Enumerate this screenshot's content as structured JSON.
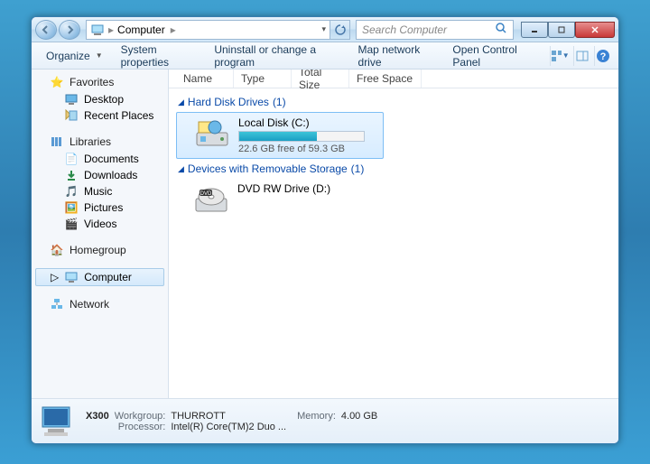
{
  "address": {
    "location": "Computer"
  },
  "search": {
    "placeholder": "Search Computer"
  },
  "toolbar": {
    "organize": "Organize",
    "system_properties": "System properties",
    "uninstall": "Uninstall or change a program",
    "map_drive": "Map network drive",
    "control_panel": "Open Control Panel"
  },
  "sidebar": {
    "favorites": {
      "label": "Favorites",
      "items": [
        "Desktop",
        "Recent Places"
      ]
    },
    "libraries": {
      "label": "Libraries",
      "items": [
        "Documents",
        "Downloads",
        "Music",
        "Pictures",
        "Videos"
      ]
    },
    "homegroup": "Homegroup",
    "computer": "Computer",
    "network": "Network"
  },
  "columns": {
    "name": "Name",
    "type": "Type",
    "total": "Total Size",
    "free": "Free Space"
  },
  "groups": {
    "hdd": {
      "label": "Hard Disk Drives",
      "count": "(1)"
    },
    "removable": {
      "label": "Devices with Removable Storage",
      "count": "(1)"
    }
  },
  "drives": {
    "c": {
      "name": "Local Disk (C:)",
      "free_text": "22.6 GB free of 59.3 GB",
      "fill_pct": 62
    },
    "d": {
      "name": "DVD RW Drive (D:)"
    }
  },
  "details": {
    "computer_name": "X300",
    "workgroup_lbl": "Workgroup:",
    "workgroup_val": "THURROTT",
    "memory_lbl": "Memory:",
    "memory_val": "4.00 GB",
    "processor_lbl": "Processor:",
    "processor_val": "Intel(R) Core(TM)2 Duo ..."
  }
}
